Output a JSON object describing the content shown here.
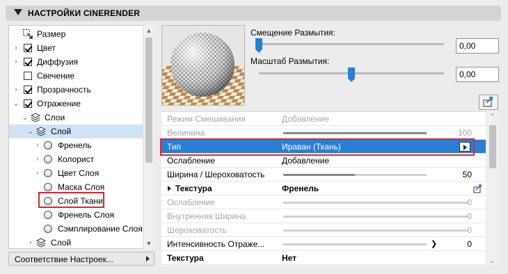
{
  "header": {
    "title": "НАСТРОЙКИ CINERENDER"
  },
  "tree": {
    "items": [
      {
        "label": "Размер"
      },
      {
        "label": "Цвет"
      },
      {
        "label": "Диффузия"
      },
      {
        "label": "Свечение"
      },
      {
        "label": "Прозрачность"
      },
      {
        "label": "Отражение"
      },
      {
        "label": "Слои"
      },
      {
        "label": "Слой"
      },
      {
        "label": "Френель"
      },
      {
        "label": "Колорист"
      },
      {
        "label": "Цвет Слоя"
      },
      {
        "label": "Маска Слоя"
      },
      {
        "label": "Слой Ткани"
      },
      {
        "label": "Френель Слоя"
      },
      {
        "label": "Сэмплирование Слоя"
      },
      {
        "label": "Слой"
      }
    ]
  },
  "bottom_dropdown": {
    "label": "Соответствие Настроек..."
  },
  "blur_offset": {
    "label": "Смещение Размытия:",
    "value": "0,00",
    "position": 0.0
  },
  "blur_scale": {
    "label": "Масштаб Размытия:",
    "value": "0,00",
    "position": 0.5
  },
  "properties": [
    {
      "key": "Режим Смешивания",
      "value": "Добавление"
    },
    {
      "key": "Величина",
      "number": "100",
      "fraction": 1.0
    },
    {
      "key": "Тип",
      "value": "Ираван (Ткань)"
    },
    {
      "key": "Ослабление",
      "value": "Добавление"
    },
    {
      "key": "Ширина / Шероховатость",
      "number": "50",
      "fraction": 0.5
    },
    {
      "key": "Текстура",
      "value": "Френель"
    },
    {
      "key": "Ослабление",
      "number": "0",
      "fraction": 0.0
    },
    {
      "key": "Внутренняя Ширина",
      "number": "0",
      "fraction": 0.0
    },
    {
      "key": "Шероховатость",
      "number": "0",
      "fraction": 0.0
    },
    {
      "key": "Интенсивность Отраже...",
      "number": "0",
      "fraction": 0.0
    },
    {
      "key": "Текстура",
      "value": "Нет"
    }
  ],
  "colors": {
    "accent": "#2a7fd4",
    "highlight_border": "#e2222a",
    "selected_tree_row": "#cfe3f6"
  }
}
